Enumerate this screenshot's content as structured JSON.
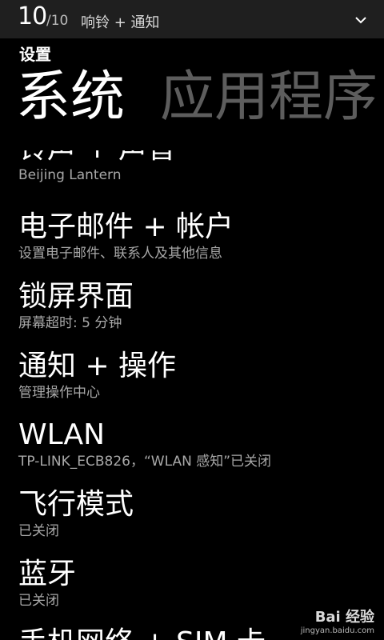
{
  "status": {
    "volume_level": "10",
    "volume_max": "/10",
    "mode": "响铃 + 通知",
    "expand_icon": "chevron-down-icon"
  },
  "header": {
    "app_title": "设置",
    "pivot_active": "系统",
    "pivot_inactive": "应用程序"
  },
  "items": [
    {
      "title": "铃声 + 声音",
      "subtitle": "Beijing Lantern"
    },
    {
      "title": "电子邮件 + 帐户",
      "subtitle": "设置电子邮件、联系人及其他信息"
    },
    {
      "title": "锁屏界面",
      "subtitle": "屏幕超时: 5 分钟"
    },
    {
      "title": "通知 + 操作",
      "subtitle": "管理操作中心"
    },
    {
      "title": "WLAN",
      "subtitle": "TP-LINK_ECB826，“WLAN 感知”已关闭"
    },
    {
      "title": "飞行模式",
      "subtitle": "已关闭"
    },
    {
      "title": "蓝牙",
      "subtitle": "已关闭"
    },
    {
      "title": "手机网络 + SIM 卡",
      "subtitle": ""
    }
  ],
  "watermark": {
    "brand": "Bai 经验",
    "url": "jingyan.baidu.com"
  }
}
